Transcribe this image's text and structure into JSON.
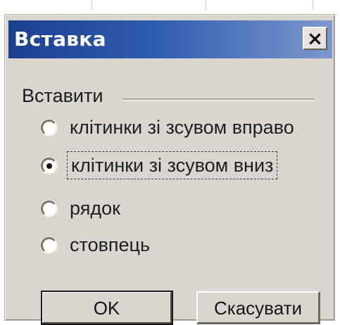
{
  "dialog": {
    "title": "Вставка",
    "close_label": "×",
    "group_label": "Вставити",
    "options": [
      {
        "label": "клітинки зі зсувом вправо",
        "selected": false
      },
      {
        "label": "клітинки зі зсувом вниз",
        "selected": true
      },
      {
        "label": "рядок",
        "selected": false
      },
      {
        "label": "стовпець",
        "selected": false
      }
    ],
    "buttons": {
      "ok_label": "OK",
      "cancel_label": "Скасувати"
    }
  },
  "colors": {
    "title_bar_start": "#1b3f8f",
    "title_bar_end": "#7c98ce",
    "dialog_background": "#d9d6cf"
  }
}
